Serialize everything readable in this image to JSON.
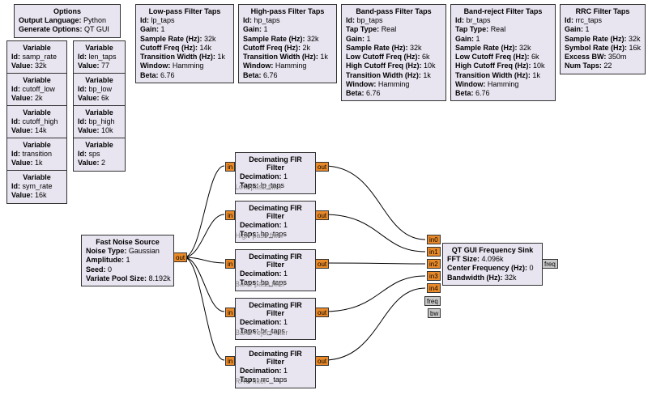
{
  "options": {
    "title": "Options",
    "k1": "Output Language:",
    "v1": "Python",
    "k2": "Generate Options:",
    "v2": "QT GUI"
  },
  "vars": {
    "title": "Variable",
    "samp_rate": {
      "id": "samp_rate",
      "val": "32k"
    },
    "cutoff_low": {
      "id": "cutoff_low",
      "val": "2k"
    },
    "cutoff_high": {
      "id": "cutoff_high",
      "val": "14k"
    },
    "transition": {
      "id": "transition",
      "val": "1k"
    },
    "sym_rate": {
      "id": "sym_rate",
      "val": "16k"
    },
    "len_taps": {
      "id": "len_taps",
      "val": "77"
    },
    "bp_low": {
      "id": "bp_low",
      "val": "6k"
    },
    "bp_high": {
      "id": "bp_high",
      "val": "10k"
    },
    "sps": {
      "id": "sps",
      "val": "2"
    }
  },
  "labels": {
    "id": "Id:",
    "value": "Value:"
  },
  "lp": {
    "title": "Low-pass Filter Taps",
    "id": "lp_taps",
    "gain": "1",
    "sr": "32k",
    "cut": "14k",
    "tw": "1k",
    "win": "Hamming",
    "beta": "6.76",
    "k_id": "Id:",
    "k_gain": "Gain:",
    "k_sr": "Sample Rate (Hz):",
    "k_cut": "Cutoff Freq (Hz):",
    "k_tw": "Transition Width (Hz):",
    "k_win": "Window:",
    "k_beta": "Beta:"
  },
  "hp": {
    "title": "High-pass Filter Taps",
    "id": "hp_taps",
    "gain": "1",
    "sr": "32k",
    "cut": "2k",
    "tw": "1k",
    "win": "Hamming",
    "beta": "6.76"
  },
  "bp": {
    "title": "Band-pass Filter Taps",
    "id": "bp_taps",
    "tt": "Real",
    "gain": "1",
    "sr": "32k",
    "lc": "6k",
    "hc": "10k",
    "tw": "1k",
    "win": "Hamming",
    "beta": "6.76",
    "k_tt": "Tap Type:",
    "k_lc": "Low Cutoff Freq (Hz):",
    "k_hc": "High Cutoff Freq (Hz):"
  },
  "br": {
    "title": "Band-reject Filter Taps",
    "id": "br_taps",
    "tt": "Real",
    "gain": "1",
    "sr": "32k",
    "lc": "6k",
    "hc": "10k",
    "tw": "1k",
    "win": "Hamming",
    "beta": "6.76"
  },
  "rrc": {
    "title": "RRC Filter Taps",
    "id": "rrc_taps",
    "gain": "1",
    "sr": "32k",
    "sym": "16k",
    "ebw": "350m",
    "nt": "22",
    "k_sym": "Symbol Rate (Hz):",
    "k_ebw": "Excess BW:",
    "k_nt": "Num Taps:"
  },
  "noise": {
    "title": "Fast Noise Source",
    "nt": "Gaussian",
    "amp": "1",
    "seed": "0",
    "vps": "8.192k",
    "k_nt": "Noise Type:",
    "k_amp": "Amplitude:",
    "k_seed": "Seed:",
    "k_vps": "Variate Pool Size:"
  },
  "fir": {
    "title": "Decimating FIR Filter",
    "k_dec": "Decimation:",
    "dec": "1",
    "k_taps": "Taps:",
    "lp": "lp_taps",
    "hp": "hp_taps",
    "bp": "bp_taps",
    "br": "br_taps",
    "rrc": "rrc_taps",
    "cap_lp": "Low-pass filter",
    "cap_hp": "High-pass filter",
    "cap_bp": "Band-pass filter",
    "cap_br": "Band-reject filter",
    "cap_rrc": "RRC filter"
  },
  "sink": {
    "title": "QT GUI Frequency Sink",
    "k_fft": "FFT Size:",
    "fft": "4.096k",
    "k_cf": "Center Frequency (Hz):",
    "cf": "0",
    "k_bw": "Bandwidth (Hz):",
    "bw": "32k"
  },
  "ports": {
    "in": "in",
    "out": "out",
    "freq": "freq",
    "bw": "bw",
    "in0": "in0",
    "in1": "in1",
    "in2": "in2",
    "in3": "in3",
    "in4": "in4"
  }
}
